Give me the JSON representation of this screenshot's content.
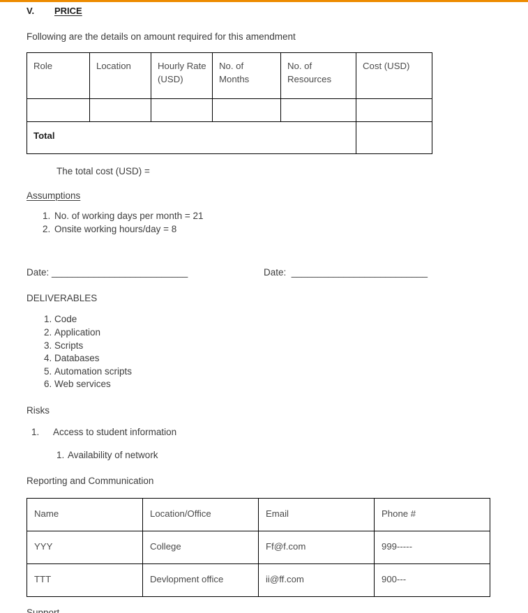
{
  "theme": {
    "accent_rule_color": "#ed8b00",
    "text_color": "#3c3c3c",
    "heading_color": "#1d1d1d",
    "table_border_color": "#000000"
  },
  "section": {
    "numeral": "V.",
    "title": "PRICE"
  },
  "intro": {
    "text": "Following are the details on amount required for this amendment"
  },
  "price_table": {
    "headers": [
      "Role",
      "Location",
      "Hourly Rate (USD)",
      "No. of Months",
      "No. of Resources",
      "Cost (USD)"
    ],
    "blank_row": [
      "",
      "",
      "",
      "",
      "",
      ""
    ],
    "total_label": "Total",
    "total_value": ""
  },
  "total_cost": {
    "text": "The total cost (USD) ="
  },
  "assumptions": {
    "heading": "Assumptions",
    "items": [
      "No. of working days per month = 21",
      "Onsite working hours/day = 8"
    ]
  },
  "signatures": {
    "left_label": "Date: __________________________",
    "right_label": "Date:  __________________________"
  },
  "deliverables": {
    "heading": "DELIVERABLES",
    "items": [
      "Code",
      "Application",
      "Scripts",
      "Databases",
      "Automation scripts",
      "Web services"
    ]
  },
  "risks": {
    "heading": "Risks",
    "items": [
      "Access to student information"
    ],
    "sub_items": [
      "Availability of network"
    ]
  },
  "reporting": {
    "heading": "Reporting and Communication"
  },
  "contact_table": {
    "headers": [
      "Name",
      "Location/Office",
      "Email",
      "Phone #"
    ],
    "rows": [
      {
        "name": "YYY",
        "location": "College",
        "email": "Ff@f.com",
        "phone": "999-----"
      },
      {
        "name": "TTT",
        "location": "Devlopment office",
        "email": "ii@ff.com",
        "phone": "900---"
      }
    ]
  },
  "bottom_clipped": {
    "text": "Support"
  }
}
